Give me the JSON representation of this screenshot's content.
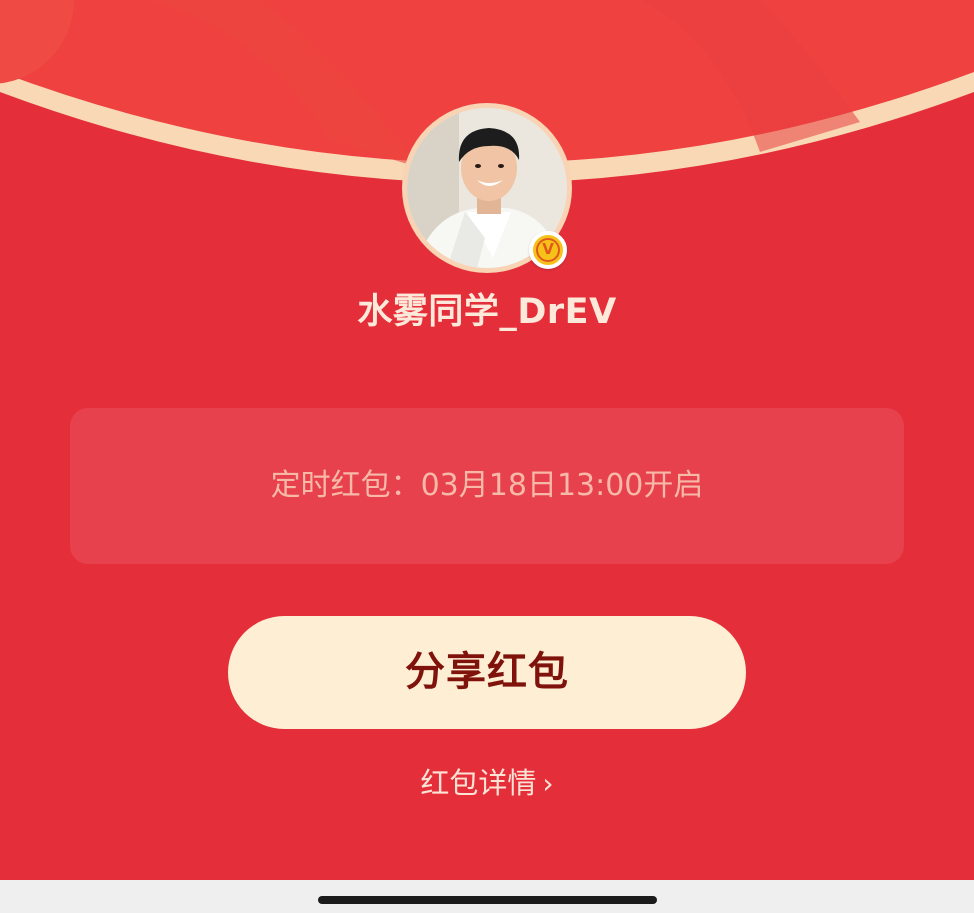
{
  "sender": {
    "username": "水雾同学_DrEV",
    "verified_mark": "V"
  },
  "envelope": {
    "info_text": "定时红包：03月18日13:00开启"
  },
  "actions": {
    "share_label": "分享红包",
    "details_label": "红包详情",
    "details_chevron": "›"
  },
  "icons": {
    "verified": "verified-badge-icon",
    "chevron": "chevron-right-icon"
  },
  "colors": {
    "envelope_red": "#e42f3b",
    "flap_red": "#ee4140",
    "flap_edge": "#f9d8b5",
    "button_cream": "#feeed3",
    "button_text": "#7f130b",
    "badge_gold": "#f6c21a",
    "bottom_bar": "#efefef"
  }
}
